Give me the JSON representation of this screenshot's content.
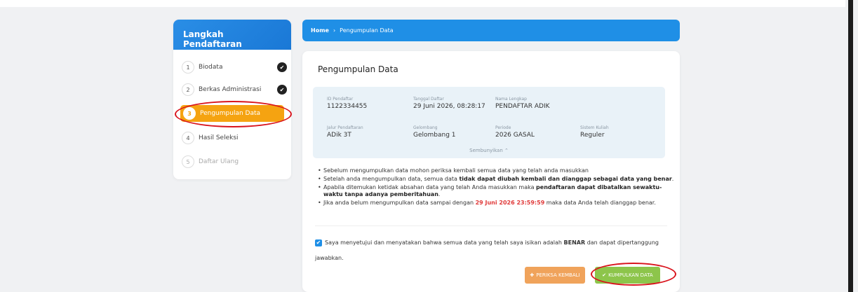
{
  "sidebar": {
    "title": "Langkah Pendaftaran",
    "steps": [
      {
        "number": "1",
        "label": "Biodata",
        "status": "done"
      },
      {
        "number": "2",
        "label": "Berkas Administrasi",
        "status": "done"
      },
      {
        "number": "3",
        "label": "Pengumpulan Data",
        "status": "active"
      },
      {
        "number": "4",
        "label": "Hasil Seleksi",
        "status": "pending"
      },
      {
        "number": "5",
        "label": "Daftar Ulang",
        "status": "disabled"
      }
    ],
    "check_glyph": "✔"
  },
  "breadcrumb": {
    "home": "Home",
    "separator": "›",
    "current": "Pengumpulan Data"
  },
  "main": {
    "title": "Pengumpulan Data",
    "info": {
      "id_label": "ID Pendaftar",
      "id_value": "1122334455",
      "date_label": "Tanggal Daftar",
      "date_value": "29 Juni 2026, 08:28:17",
      "name_label": "Nama Lengkap",
      "name_value": "PENDAFTAR ADIK",
      "path_label": "Jalur Pendaftaran",
      "path_value": "ADik 3T",
      "wave_label": "Gelombang",
      "wave_value": "Gelombang 1",
      "period_label": "Periode",
      "period_value": "2026 GASAL",
      "system_label": "Sistem Kuliah",
      "system_value": "Reguler",
      "hide_link": "Sembunyikan ⌃"
    },
    "notes": {
      "n1": "Sebelum mengumpulkan data mohon periksa kembali semua data yang telah anda masukkan",
      "n2_a": "Setelah anda mengumpulkan data, semua data ",
      "n2_b": "tidak dapat diubah kembali dan dianggap sebagai data yang benar",
      "n2_c": ".",
      "n3_a": "Apabila ditemukan ketidak absahan data yang telah Anda masukkan maka ",
      "n3_b": "pendaftaran dapat dibatalkan sewaktu-waktu tanpa adanya pemberitahuan",
      "n3_c": ".",
      "n4_a": "Jika anda belum mengumpulkan data sampai dengan ",
      "n4_b": "29 Juni 2026 23:59:59",
      "n4_c": " maka data Anda telah dianggap benar."
    },
    "agreement": {
      "checked": true,
      "text_a": "Saya menyetujui dan menyatakan bahwa semua data yang telah saya isikan adalah ",
      "text_b": "BENAR",
      "text_c": " dan dapat dipertanggung jawabkan."
    },
    "buttons": {
      "check_label": "PERIKSA KEMBALI",
      "check_icon": "✚",
      "submit_label": "KUMPULKAN DATA",
      "submit_icon": "✔"
    }
  },
  "colors": {
    "primary": "#1f8fe6",
    "active_step": "#f5a311",
    "check_button": "#f0a35b",
    "submit_button": "#8dc54b",
    "highlight": "#d9141d",
    "deadline": "#e03a3a"
  }
}
